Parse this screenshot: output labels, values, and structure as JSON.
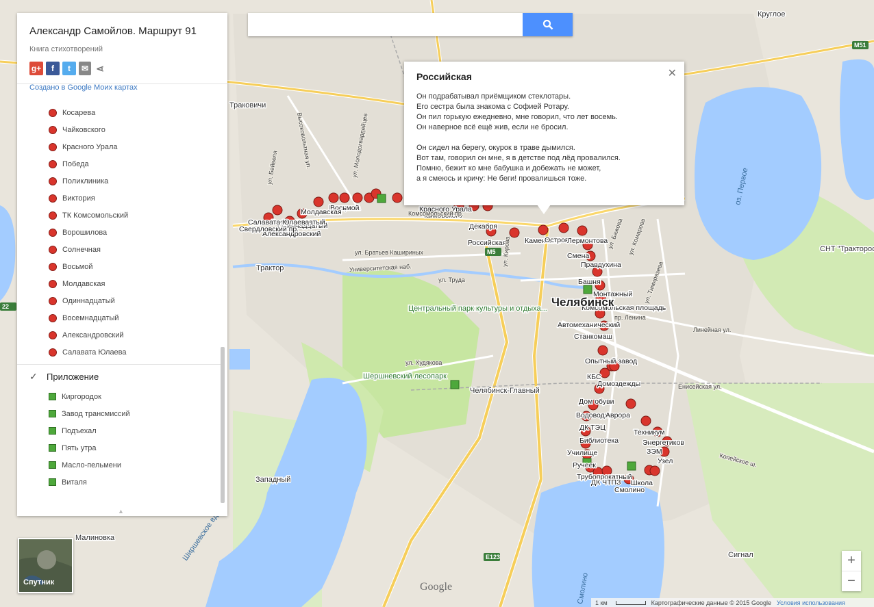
{
  "panel": {
    "title": "Александр Самойлов. Маршрут 91",
    "subtitle": "Книга стихотворений",
    "created": "Создано в Google Моих картах",
    "stops": [
      "Косарева",
      "Чайковского",
      "Красного Урала",
      "Победа",
      "Поликлиника",
      "Виктория",
      "ТК Комсомольский",
      "Ворошилова",
      "Солнечная",
      "Восьмой",
      "Молдавская",
      "Одиннадцатый",
      "Восемнадцатый",
      "Александровский",
      "Салавата Юлаева"
    ],
    "layer2_name": "Приложение",
    "appendix": [
      "Киргородок",
      "Завод трансмиссий",
      "Подъехал",
      "Пять утра",
      "Масло-пельмени",
      "Виталя"
    ]
  },
  "search": {
    "value": "",
    "placeholder": ""
  },
  "info": {
    "title": "Российская",
    "lines": [
      "Он подрабатывал приёмщиком стеклотары.",
      "Его сестра была знакома с Софией Ротару.",
      "Он пил горькую ежедневно, мне говорил, что лет восемь.",
      "Он наверное всё ещё жив, если не бросил.",
      "",
      "Он сидел на берегу, окурок в траве дымился.",
      "Вот там, говорил он мне, я в детстве под лёд провалился.",
      "Помню, бежит ко мне бабушка и добежать не может,",
      "а я смеюсь и кричу: Не беги! провалишься тоже."
    ]
  },
  "map": {
    "city": "Челябинск",
    "places": [
      "Круглое",
      "Малиновка",
      "Западный",
      "Трактор",
      "СНТ \"Тракторос",
      "Сигнал",
      "Ширшевское вдхр.",
      "оз. Первое",
      "оз. Смолино",
      "Центральный парк культуры и отдыха...",
      "Шершневский лесопарк",
      "Челябинск-Главный",
      "Смолино",
      "Траковичи"
    ],
    "map_labels": [
      "Косарева",
      "Чайковского",
      "Красного Урала",
      "Победа",
      "Поликлиника",
      "Виктория",
      "ТК Комсомольский",
      "Ворошилова",
      "Восьмой",
      "Молдавская",
      "Одиннадцатый",
      "Восемнадцатый",
      "Александровский",
      "Салавата Юлаева",
      "Свердловский пр.",
      "Российская",
      "Каменский",
      "Островского",
      "Декабря",
      "Лермонтова",
      "Смена",
      "Правдухина",
      "Башня",
      "Монтажный",
      "Комсомольская площадь",
      "Автомеханический",
      "Станкомаш",
      "Опытный завод",
      "КБС",
      "Домоздежды",
      "Дом обуви",
      "Водоводная",
      "Аврора",
      "ДК ТЭЦ",
      "Техникум",
      "Энергетиков",
      "ЗЭМ",
      "Узел",
      "Библиотека",
      "Училище",
      "Ручеек",
      "Трубопрокатный",
      "ДК ЧТПЗ",
      "Школа",
      "Смолино"
    ],
    "streets": [
      "ул. Бейвеля",
      "ул. Молодогвардейцев",
      "Комсомольский пр.",
      "ул. Братьев Кашириных",
      "Университетская наб.",
      "ул. Труда",
      "ул. Худякова",
      "ул. Кирова",
      "пр. Ленина",
      "ул. Бажова",
      "ул. Комарова",
      "ул. Тимирязева",
      "Копейское ш.",
      "Енисейская ул.",
      "Линейная ул.",
      "Высоковольтная ул."
    ],
    "shields": [
      "M5",
      "M51",
      "E123",
      "22"
    ],
    "colors": {
      "stop": "#d9352c",
      "appendix": "#4ea83b",
      "water": "#a3ccff",
      "park": "#c7e6a1",
      "land": "#f0ede5",
      "road_major": "#f6ce5a"
    }
  },
  "sat_label": "Спутник",
  "zoom": {
    "in": "+",
    "out": "−"
  },
  "attribution": {
    "scale": "1 км",
    "data": "Картографические данные © 2015 Google",
    "terms": "Условия использования"
  },
  "google_logo": "Google"
}
